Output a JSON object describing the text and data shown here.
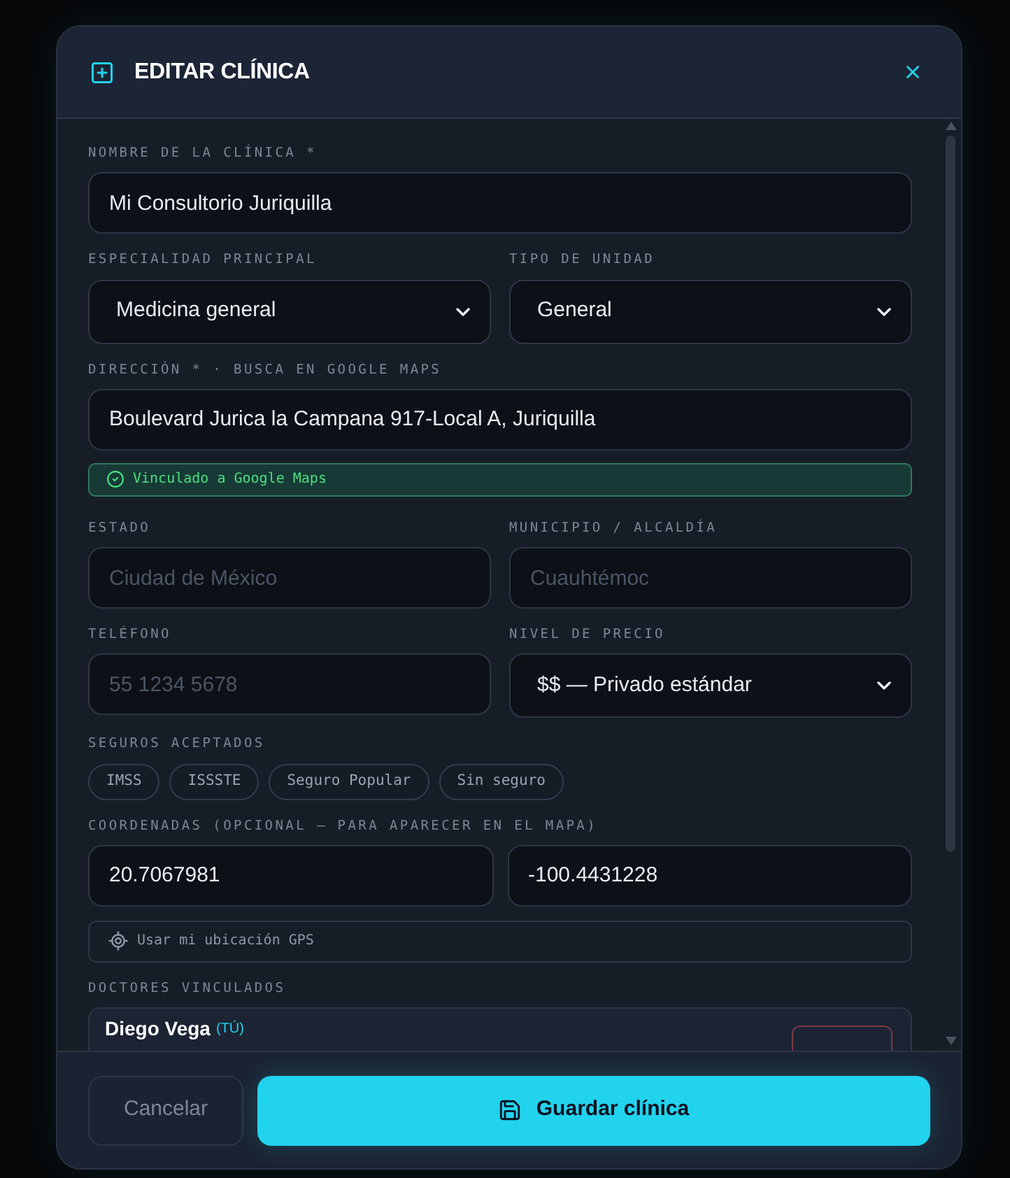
{
  "dialog": {
    "title": "EDITAR CLÍNICA"
  },
  "fields": {
    "name": {
      "label": "NOMBRE DE LA CLÍNICA *",
      "value": "Mi Consultorio Juriquilla"
    },
    "specialty": {
      "label": "ESPECIALIDAD PRINCIPAL",
      "value": "Medicina general"
    },
    "unit_type": {
      "label": "TIPO DE UNIDAD",
      "value": "General"
    },
    "address": {
      "label": "DIRECCIÓN * · BUSCA EN GOOGLE MAPS",
      "value": "Boulevard Jurica la Campana 917-Local A, Juriquilla"
    },
    "maps_status": {
      "text": "Vinculado a Google Maps",
      "linked": true
    },
    "state": {
      "label": "ESTADO",
      "placeholder": "Ciudad de México"
    },
    "municipality": {
      "label": "MUNICIPIO / ALCALDÍA",
      "placeholder": "Cuauhtémoc"
    },
    "phone": {
      "label": "TELÉFONO",
      "placeholder": "55 1234 5678"
    },
    "price_level": {
      "label": "NIVEL DE PRECIO",
      "value": "$$ — Privado estándar"
    }
  },
  "insurance": {
    "label": "SEGUROS ACEPTADOS",
    "options": [
      {
        "label": "IMSS",
        "selected": false
      },
      {
        "label": "ISSSTE",
        "selected": false
      },
      {
        "label": "Seguro Popular",
        "selected": false
      },
      {
        "label": "Sin seguro",
        "selected": false
      }
    ]
  },
  "coordinates": {
    "label": "COORDENADAS (OPCIONAL — PARA APARECER EN EL MAPA)",
    "latitude": "20.7067981",
    "longitude": "-100.4431228",
    "gps_button": "Usar mi ubicación GPS"
  },
  "doctors": {
    "label": "DOCTORES VINCULADOS",
    "items": [
      {
        "name": "Diego Vega",
        "tag": "(TÚ)"
      }
    ]
  },
  "footer": {
    "cancel": "Cancelar",
    "save": "Guardar clínica"
  }
}
